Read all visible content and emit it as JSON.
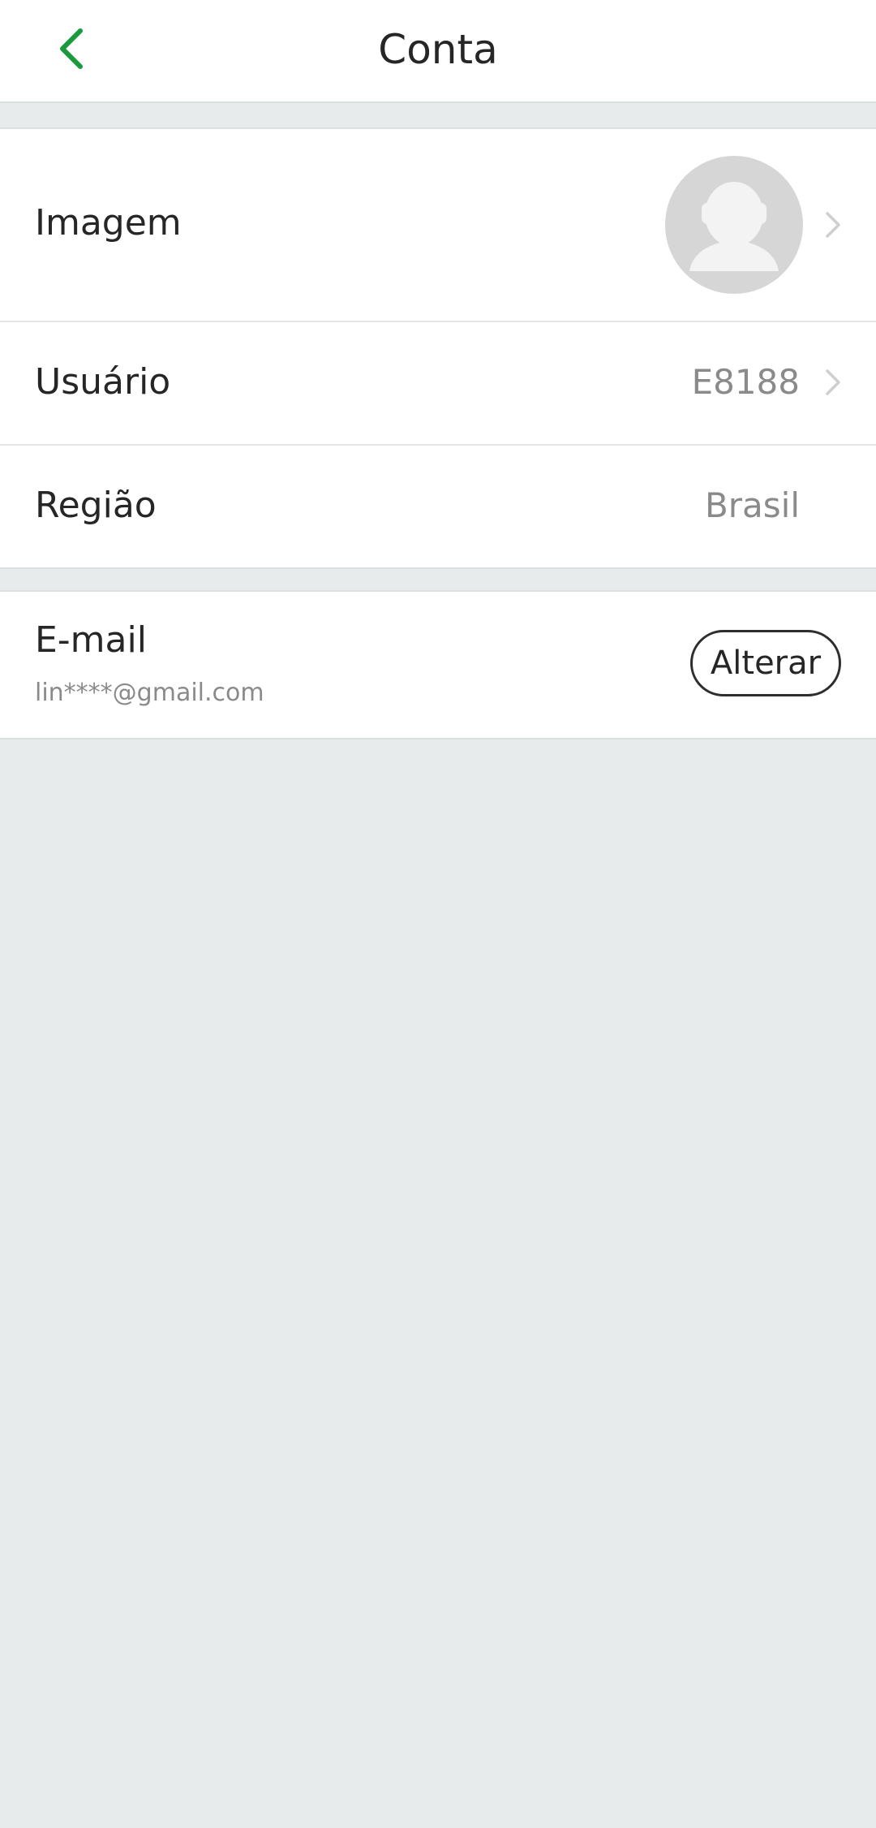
{
  "header": {
    "title": "Conta",
    "back_icon": "chevron-left-icon",
    "accent_color": "#1a9a3c"
  },
  "profile": {
    "image_label": "Imagem",
    "avatar_icon": "default-avatar-icon",
    "user_label": "Usuário",
    "user_value": "E8188",
    "region_label": "Região",
    "region_value": "Brasil"
  },
  "email": {
    "label": "E-mail",
    "value": "lin****@gmail.com",
    "change_button": "Alterar"
  }
}
